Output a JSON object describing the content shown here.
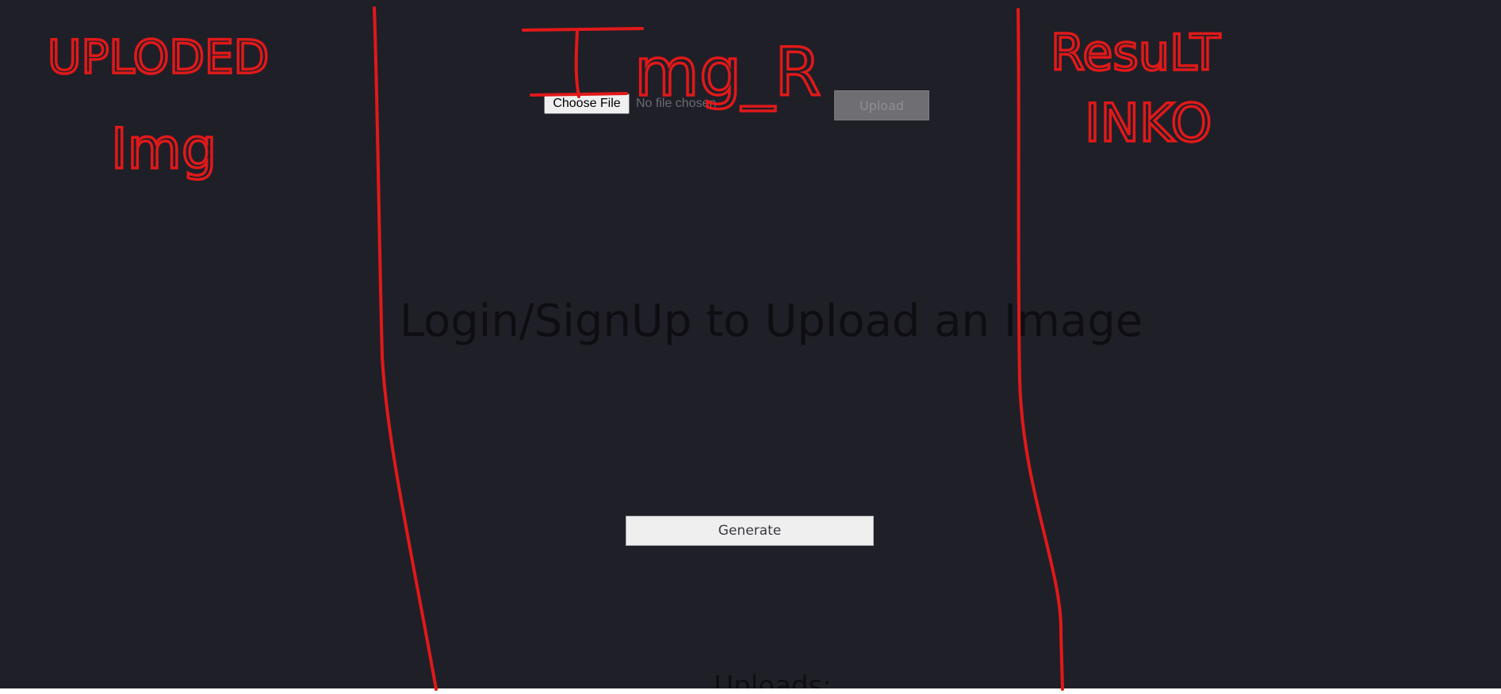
{
  "file_input": {
    "button_label": "Choose File",
    "status": "No file chosen"
  },
  "upload_button": {
    "label": "Upload"
  },
  "main_message": "Login/SignUp to Upload an Image",
  "generate_button": {
    "label": "Generate"
  },
  "uploads_heading": "Uploads:",
  "annotations": {
    "left_note": "UPLODED Img",
    "center_note": "Img_R",
    "right_note": "ResuLT INKO",
    "color": "#e01919"
  },
  "colors": {
    "background": "#1f1f28",
    "button_light": "#efefef",
    "button_disabled": "#6f6f73",
    "annotation_red": "#e01919"
  }
}
